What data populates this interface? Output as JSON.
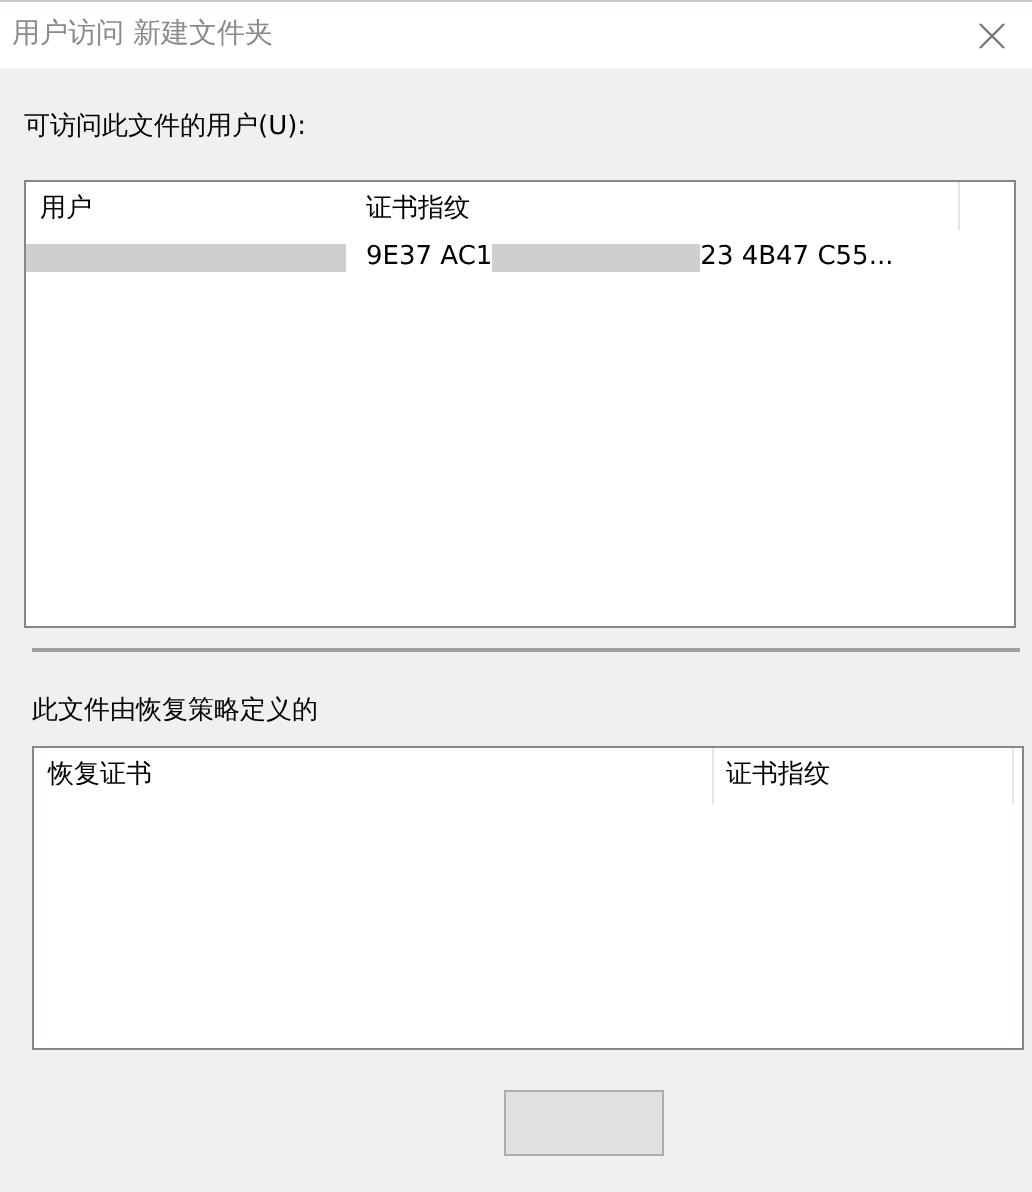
{
  "window": {
    "title": "用户访问 新建文件夹"
  },
  "users_section": {
    "label": "可访问此文件的用户(U):",
    "columns": [
      "用户",
      "证书指纹"
    ],
    "rows": [
      {
        "user_redacted": true,
        "fingerprint_start": "9E37 AC1",
        "fingerprint_redacted": true,
        "fingerprint_end": "23 4B47 C55..."
      }
    ]
  },
  "recovery_section": {
    "label": "此文件由恢复策略定义的",
    "columns": [
      "恢复证书",
      "证书指纹"
    ]
  },
  "buttons": [
    {
      "disabled": false
    }
  ]
}
